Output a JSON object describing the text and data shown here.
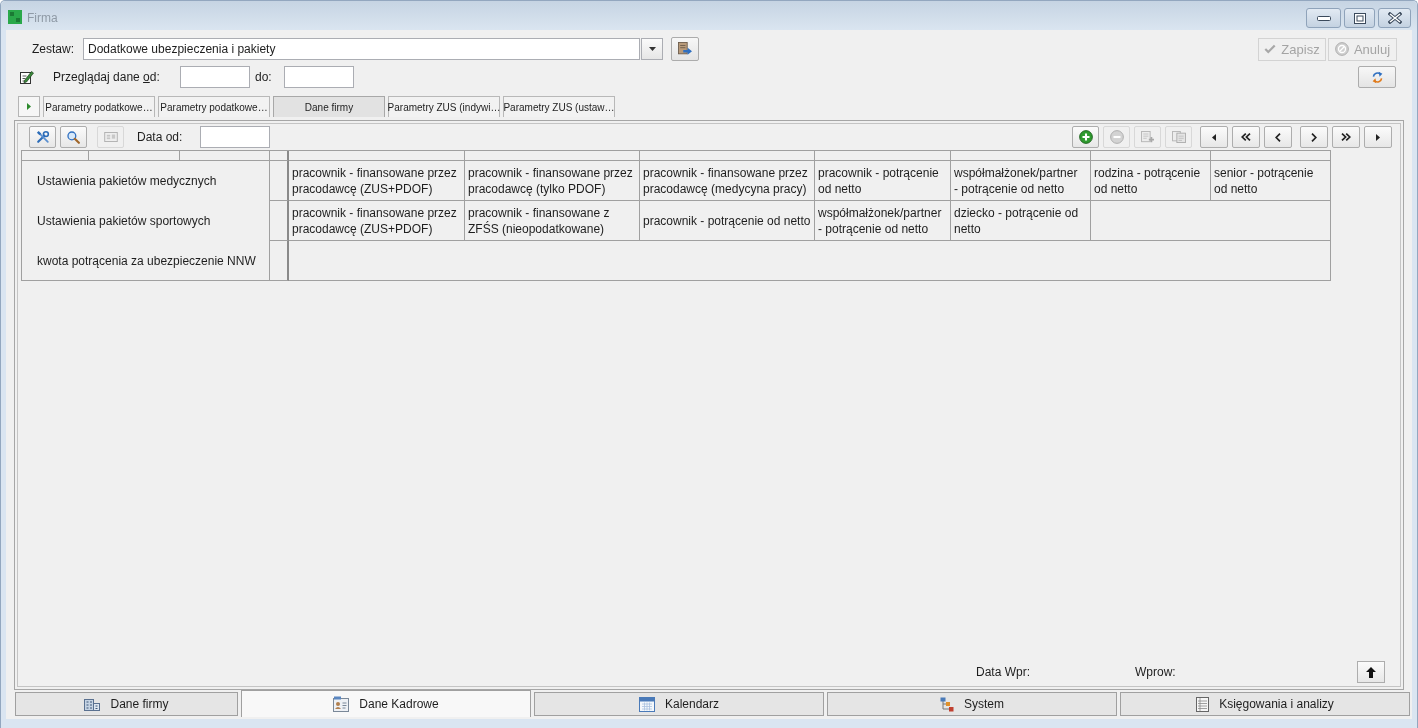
{
  "window": {
    "title": "Firma"
  },
  "set_selector": {
    "label": "Zestaw:",
    "value": "Dodatkowe ubezpieczenia i pakiety"
  },
  "actions": [
    {
      "kind": "save",
      "label": "Zapisz",
      "disabled": true
    },
    {
      "kind": "cancel",
      "label": "Anuluj",
      "disabled": true
    }
  ],
  "date_filter": {
    "label_before": "Przeglądaj dane ",
    "access_key": "o",
    "label_after": "d:",
    "to_label": "do:"
  },
  "top_tabs": [
    {
      "label": "Parametry podatkowe…",
      "selected": false
    },
    {
      "label": "Parametry podatkowe…",
      "selected": false
    },
    {
      "label": "Dane firmy",
      "selected": true
    },
    {
      "label": "Parametry ZUS (indywi…",
      "selected": false
    },
    {
      "label": "Parametry ZUS (ustaw…",
      "selected": false
    }
  ],
  "toolbar": {
    "left_buttons": [
      {
        "kind": "tools",
        "disabled": false
      },
      {
        "kind": "search",
        "disabled": false
      },
      {
        "kind": "card",
        "disabled": true
      }
    ],
    "date_label": "Data od:",
    "edit_buttons": [
      {
        "kind": "add",
        "disabled": false
      },
      {
        "kind": "remove",
        "disabled": true
      },
      {
        "kind": "add-document",
        "disabled": true
      },
      {
        "kind": "copy-document",
        "disabled": true
      }
    ],
    "nav_back": [
      {
        "kind": "triangle-left"
      },
      {
        "kind": "double-left"
      },
      {
        "kind": "left"
      }
    ],
    "nav_forward": [
      {
        "kind": "right"
      },
      {
        "kind": "double-right"
      },
      {
        "kind": "triangle-right"
      }
    ]
  },
  "table": {
    "rows": [
      {
        "label": "Ustawienia pakietów medycznych",
        "cells": [
          "pracownik - finansowane przez pracodawcę (ZUS+PDOF)",
          "pracownik - finansowane przez pracodawcę (tylko PDOF)",
          "pracownik - finansowane przez pracodawcę (medycyna pracy)",
          "pracownik - potrącenie od netto",
          "współmałżonek/partner - potrącenie od netto",
          "rodzina - potrącenie od netto",
          "senior - potrącenie od netto"
        ]
      },
      {
        "label": "Ustawienia pakietów sportowych",
        "cells": [
          "pracownik - finansowane przez pracodawcę (ZUS+PDOF)",
          "pracownik - finansowane z ZFŚS (nieopodatkowane)",
          "pracownik - potrącenie od netto",
          "współmałżonek/partner - potrącenie od netto",
          "dziecko - potrącenie od netto"
        ]
      },
      {
        "label": "kwota potrącenia za ubezpieczenie NNW",
        "cells": []
      }
    ]
  },
  "footer": {
    "date_label": "Data Wpr:",
    "author_label": "Wprow:"
  },
  "bottom_tabs": [
    {
      "kind": "building",
      "label": "Dane firmy",
      "selected": false
    },
    {
      "kind": "id-card",
      "label": "Dane Kadrowe",
      "selected": true
    },
    {
      "kind": "calendar",
      "label": "Kalendarz",
      "selected": false
    },
    {
      "kind": "diagram",
      "label": "System",
      "selected": false
    },
    {
      "kind": "ledger",
      "label": "Księgowania i analizy",
      "selected": false
    }
  ]
}
